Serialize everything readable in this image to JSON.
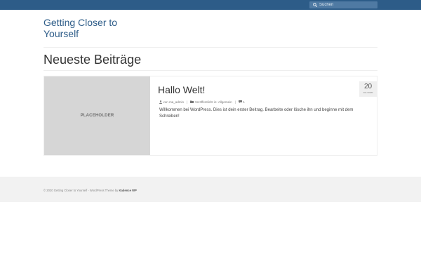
{
  "header": {
    "search_placeholder": "Suchen"
  },
  "site": {
    "title": "Getting Closer to Yourself"
  },
  "page": {
    "heading": "Neueste Beiträge"
  },
  "post": {
    "thumbnail_label": "PLACEHOLDER",
    "title": "Hallo Welt!",
    "date_day": "20",
    "date_month_year": "JULI 2020",
    "author_prefix": "von",
    "author": "ma_admin",
    "category_prefix": "Veröffentlicht in",
    "category": "Allgemein",
    "comments_count": "1",
    "excerpt": "Willkommen bei WordPress. Dies ist dein erster Beitrag. Bearbeite oder lösche ihn und beginne mit dem Schreiben!"
  },
  "footer": {
    "copyright": "© 2020 Getting Closer to Yourself - WordPress Theme by",
    "theme_link": "Kadence WP"
  },
  "colors": {
    "topbar": "#2d5c88",
    "accent": "#2d5c88",
    "footer_bg": "#f2f2f2"
  },
  "icons": [
    "search-icon",
    "user-icon",
    "folder-icon",
    "comment-icon"
  ]
}
